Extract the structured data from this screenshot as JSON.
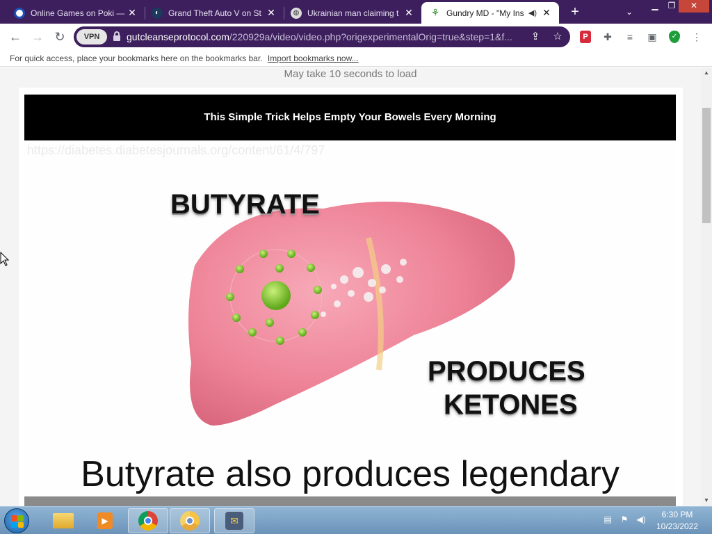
{
  "browser": {
    "tabs": [
      {
        "title": "Online Games on Poki —",
        "icon": "poki-icon",
        "active": false
      },
      {
        "title": "Grand Theft Auto V on St",
        "icon": "steam-icon",
        "active": false
      },
      {
        "title": "Ukrainian man claiming t",
        "icon": "globe-icon",
        "active": false
      },
      {
        "title": "Gundry MD - \"My Ins",
        "icon": "sprout-icon",
        "active": true
      }
    ],
    "new_tab_label": "+",
    "omnibox": {
      "vpn_label": "VPN",
      "url_domain": "gutcleanseprotocol.com",
      "url_path": "/220929a/video/video.php?origexperimentalOrig=true&step=1&f..."
    },
    "bookmarks_bar": {
      "text": "For quick access, place your bookmarks here on the bookmarks bar.",
      "link": "Import bookmarks now..."
    }
  },
  "page": {
    "load_note": "May take 10 seconds to load",
    "headline": "This Simple Trick Helps Empty Your Bowels Every Morning",
    "video": {
      "ghost_url": "https://diabetes.diabetesjournals.org/content/61/4/797",
      "label_top": "BUTYRATE",
      "label_right_1": "PRODUCES",
      "label_right_2": "KETONES",
      "caption": "Butyrate also produces legendary"
    }
  },
  "taskbar": {
    "time": "6:30 PM",
    "date": "10/23/2022"
  },
  "colors": {
    "browser_frame": "#3c1f5c",
    "headline_bg": "#000000",
    "taskbar": "#7aa3c8"
  }
}
